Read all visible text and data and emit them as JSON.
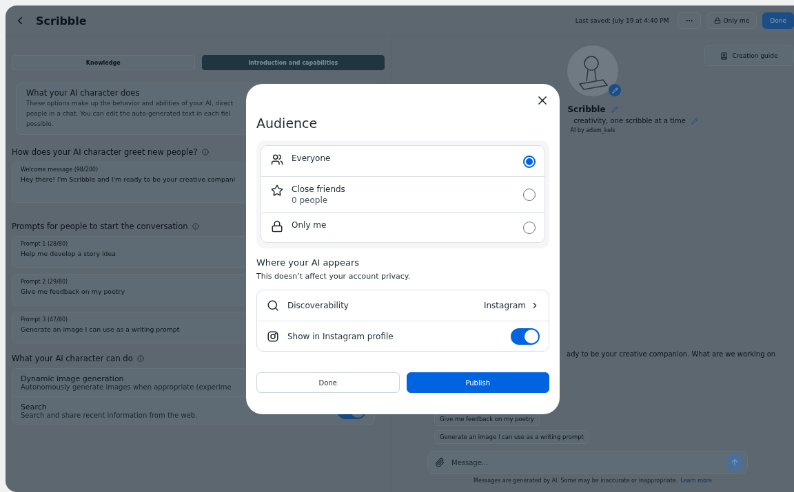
{
  "header": {
    "title": "Scribble",
    "last_saved": "Last saved: July 19 at 4:40 PM",
    "audience_button": "Only me",
    "done_button": "Done"
  },
  "tabs": [
    {
      "label": "Knowledge",
      "selected": false
    },
    {
      "label": "Introduction and capabilities",
      "selected": true
    }
  ],
  "intro_card": {
    "title": "What your AI character does",
    "lines": [
      "These options make up the behavior and abilities of your AI, direct",
      "people in a chat. You can edit the auto-generated text in each fiel",
      "possible."
    ]
  },
  "greeting": {
    "heading": "How does your AI character greet new people?",
    "label": "Welcome message (98/200)",
    "value": "Hey there! I'm Scribble and I'm ready to be your creative compani"
  },
  "prompts": {
    "heading": "Prompts for people to start the conversation",
    "items": [
      {
        "label": "Prompt 1 (28/80)",
        "value": "Help me develop a story idea"
      },
      {
        "label": "Prompt 2 (29/80)",
        "value": "Give me feedback on my poetry"
      },
      {
        "label": "Prompt 3 (47/80)",
        "value": "Generate an image I can use as a writing prompt"
      }
    ]
  },
  "capabilities": {
    "heading": "What your AI character can do",
    "items": [
      {
        "title": "Dynamic image generation",
        "description": "Autonomously generate images when appropriate (experime"
      },
      {
        "title": "Search",
        "description": "Search and share recent information from the web.",
        "on": true
      }
    ]
  },
  "preview": {
    "creation_guide": "Creation guide",
    "name": "Scribble",
    "tagline": "creativity, one scribble at a time",
    "author": "AI by adam_kels",
    "greeting": "ady to be your creative companion. What are we working on",
    "chips": [
      "Give me feedback on my poetry",
      "Generate an image I can use as a writing prompt"
    ],
    "message_placeholder": "Message...",
    "disclaimer": "Messages are generated by AI. Some may be inaccurate or inappropriate.",
    "disclaimer_link": "Learn more"
  },
  "modal": {
    "title": "Audience",
    "options": [
      {
        "label": "Everyone",
        "selected": true
      },
      {
        "label": "Close friends",
        "sublabel": "0 people",
        "selected": false
      },
      {
        "label": "Only me",
        "selected": false
      }
    ],
    "section_title": "Where your AI appears",
    "section_note": "This doesn’t affect your account privacy.",
    "settings": [
      {
        "kind": "link",
        "label": "Discoverability",
        "value": "Instagram"
      },
      {
        "kind": "toggle",
        "label": "Show in Instagram profile",
        "on": true
      }
    ],
    "secondary_button": "Done",
    "primary_button": "Publish"
  }
}
